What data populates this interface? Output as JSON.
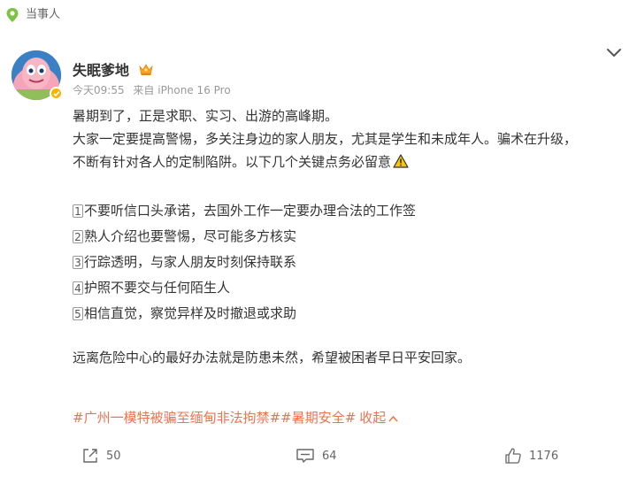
{
  "header": {
    "tag_label": "当事人"
  },
  "user": {
    "name": "失眠爹地",
    "meta_time": "今天09:55",
    "meta_source": "来自 iPhone 16 Pro"
  },
  "post": {
    "line1": "暑期到了，正是求职、实习、出游的高峰期。",
    "line2": "大家一定要提高警惕，多关注身边的家人朋友，尤其是学生和未成年人。骗术在升级，",
    "line3": "不断有针对各人的定制陷阱。以下几个关键点务必留意",
    "items": [
      {
        "num": "1",
        "text": "不要听信口头承诺，去国外工作一定要办理合法的工作签"
      },
      {
        "num": "2",
        "text": "熟人介绍也要警惕，尽可能多方核实"
      },
      {
        "num": "3",
        "text": "行踪透明，与家人朋友时刻保持联系"
      },
      {
        "num": "4",
        "text": "护照不要交与任何陌生人"
      },
      {
        "num": "5",
        "text": "相信直觉，察觉异样及时撤退或求助"
      }
    ],
    "closing": "远离危险中心的最好办法就是防患未然，希望被困者早日平安回家。"
  },
  "topics": {
    "topic1": "#广州一模特被骗至缅甸非法拘禁#",
    "topic2": "#暑期安全#",
    "collapse_label": "收起"
  },
  "actions": {
    "share_count": "50",
    "comment_count": "64",
    "like_count": "1176"
  },
  "colors": {
    "accent": "#eb7350",
    "pin_green": "#7dc242",
    "text_main": "#333333",
    "text_meta": "#999999"
  },
  "icons": {
    "location": "location-pin-icon",
    "crown": "crown-icon",
    "more": "chevron-down-icon",
    "warning": "warning-icon",
    "share": "share-icon",
    "comment": "comment-icon",
    "like": "like-icon"
  }
}
